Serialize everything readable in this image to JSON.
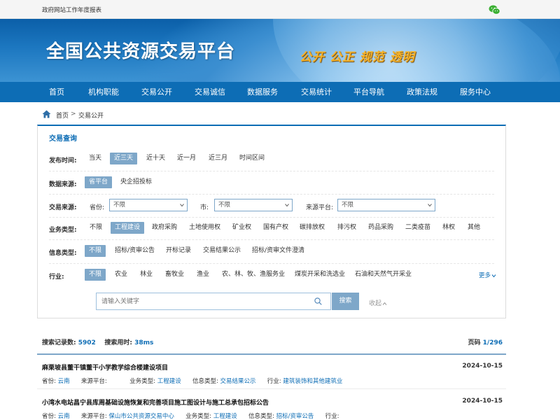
{
  "topbar": {
    "report_link": "政府网站工作年度报表",
    "wechat_icon": "wechat-icon"
  },
  "banner": {
    "title": "全国公共资源交易平台",
    "slogan": "公开 公正 规范 透明"
  },
  "nav": {
    "items": [
      "首页",
      "机构职能",
      "交易公开",
      "交易诚信",
      "数据服务",
      "交易统计",
      "平台导航",
      "政策法规",
      "服务中心"
    ]
  },
  "breadcrumb": {
    "home": "首页",
    "separator": ">",
    "current": "交易公开"
  },
  "query": {
    "title": "交易查询",
    "publish_time": {
      "label": "发布时间:",
      "options": [
        "当天",
        "近三天",
        "近十天",
        "近一月",
        "近三月",
        "时间区间"
      ],
      "active": "近三天"
    },
    "data_source": {
      "label": "数据来源:",
      "options": [
        "省平台",
        "央企招投标"
      ],
      "active": "省平台"
    },
    "trade_source": {
      "label": "交易来源:",
      "province_label": "省份:",
      "province_value": "不限",
      "city_label": "市:",
      "city_value": "不限",
      "platform_label": "来源平台:",
      "platform_value": "不限"
    },
    "business_type": {
      "label": "业务类型:",
      "options": [
        "不限",
        "工程建设",
        "政府采购",
        "土地使用权",
        "矿业权",
        "国有产权",
        "碳排放权",
        "排污权",
        "药品采购",
        "二类疫苗",
        "林权",
        "其他"
      ],
      "active": "工程建设"
    },
    "info_type": {
      "label": "信息类型:",
      "options": [
        "不限",
        "招标/资审公告",
        "开标记录",
        "交易结果公示",
        "招标/资审文件澄清"
      ],
      "active": "不限"
    },
    "industry": {
      "label": "行业:",
      "options": [
        "不限",
        "农业",
        "林业",
        "畜牧业",
        "渔业",
        "农、林、牧、渔服务业",
        "煤炭开采和洗选业",
        "石油和天然气开采业"
      ],
      "active": "不限",
      "more": "更多"
    },
    "search": {
      "placeholder": "请输入关键字",
      "button": "搜索",
      "collapse": "收起"
    }
  },
  "stats": {
    "records_label": "搜索记录数:",
    "records": "5902",
    "time_label": "搜索用时:",
    "time": "38ms",
    "page_label": "页码",
    "page": "1/296"
  },
  "results": [
    {
      "title": "麻栗坡县董干镇董干小学教学综合楼建设项目",
      "date": "2024-10-15",
      "province_label": "省份:",
      "province": "云南",
      "source_label": "来源平台:",
      "source": "",
      "business_label": "业务类型:",
      "business": "工程建设",
      "info_label": "信息类型:",
      "info": "交易结果公示",
      "industry_label": "行业:",
      "industry": "建筑装饰和其他建筑业"
    },
    {
      "title": "小湾水电站昌宁县库周基础设施恢复和完善项目施工图设计与施工总承包招标公告",
      "date": "2024-10-15",
      "province_label": "省份:",
      "province": "云南",
      "source_label": "来源平台:",
      "source": "保山市公共资源交易中心",
      "business_label": "业务类型:",
      "business": "工程建设",
      "info_label": "信息类型:",
      "info": "招标/资审公告",
      "industry_label": "行业:",
      "industry": ""
    }
  ]
}
